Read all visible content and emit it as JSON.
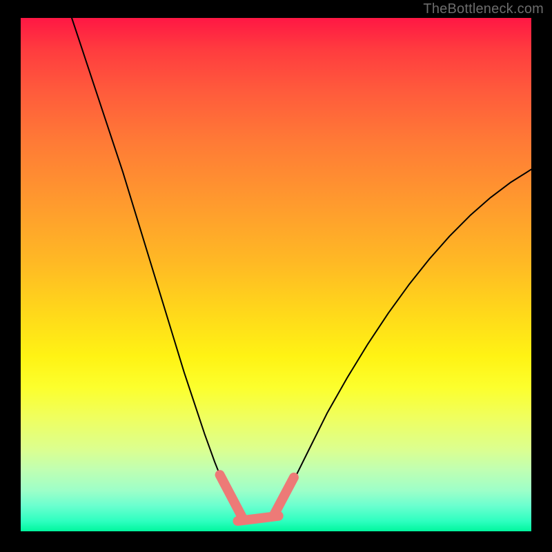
{
  "watermark": "TheBottleneck.com",
  "chart_data": {
    "type": "line",
    "title": "",
    "xlabel": "",
    "ylabel": "",
    "xlim": [
      0,
      100
    ],
    "ylim": [
      0,
      100
    ],
    "grid": false,
    "legend": false,
    "series": [
      {
        "name": "curve-left",
        "stroke": "#000000",
        "points": [
          {
            "x": 10.0,
            "y": 100.0
          },
          {
            "x": 12.0,
            "y": 94.0
          },
          {
            "x": 14.0,
            "y": 88.0
          },
          {
            "x": 16.0,
            "y": 82.0
          },
          {
            "x": 18.0,
            "y": 76.0
          },
          {
            "x": 20.0,
            "y": 70.0
          },
          {
            "x": 22.0,
            "y": 63.5
          },
          {
            "x": 24.0,
            "y": 57.0
          },
          {
            "x": 26.0,
            "y": 50.5
          },
          {
            "x": 28.0,
            "y": 44.0
          },
          {
            "x": 30.0,
            "y": 37.5
          },
          {
            "x": 32.0,
            "y": 31.0
          },
          {
            "x": 34.0,
            "y": 25.0
          },
          {
            "x": 36.0,
            "y": 19.0
          },
          {
            "x": 38.0,
            "y": 13.5
          },
          {
            "x": 40.0,
            "y": 8.5
          },
          {
            "x": 42.0,
            "y": 5.0
          },
          {
            "x": 43.5,
            "y": 3.0
          }
        ]
      },
      {
        "name": "curve-right",
        "stroke": "#000000",
        "points": [
          {
            "x": 50.0,
            "y": 4.0
          },
          {
            "x": 52.0,
            "y": 7.0
          },
          {
            "x": 54.0,
            "y": 11.0
          },
          {
            "x": 57.0,
            "y": 17.0
          },
          {
            "x": 60.0,
            "y": 23.0
          },
          {
            "x": 64.0,
            "y": 30.0
          },
          {
            "x": 68.0,
            "y": 36.5
          },
          {
            "x": 72.0,
            "y": 42.5
          },
          {
            "x": 76.0,
            "y": 48.0
          },
          {
            "x": 80.0,
            "y": 53.0
          },
          {
            "x": 84.0,
            "y": 57.5
          },
          {
            "x": 88.0,
            "y": 61.5
          },
          {
            "x": 92.0,
            "y": 65.0
          },
          {
            "x": 96.0,
            "y": 68.0
          },
          {
            "x": 100.0,
            "y": 70.5
          }
        ]
      },
      {
        "name": "highlight-left",
        "stroke": "#ed7a77",
        "points": [
          {
            "x": 39.0,
            "y": 11.0
          },
          {
            "x": 43.5,
            "y": 2.5
          }
        ]
      },
      {
        "name": "highlight-bottom",
        "stroke": "#ed7a77",
        "points": [
          {
            "x": 42.5,
            "y": 2.0
          },
          {
            "x": 50.5,
            "y": 3.0
          }
        ]
      },
      {
        "name": "highlight-right",
        "stroke": "#ed7a77",
        "points": [
          {
            "x": 49.5,
            "y": 3.0
          },
          {
            "x": 53.5,
            "y": 10.5
          }
        ]
      }
    ],
    "gradient_stops": [
      {
        "pos": 0.0,
        "color": "#ff1744"
      },
      {
        "pos": 0.5,
        "color": "#ffda1a"
      },
      {
        "pos": 0.72,
        "color": "#efff60"
      },
      {
        "pos": 1.0,
        "color": "#00f79d"
      }
    ]
  },
  "dims": {
    "inner_w": 740,
    "inner_h": 744
  }
}
